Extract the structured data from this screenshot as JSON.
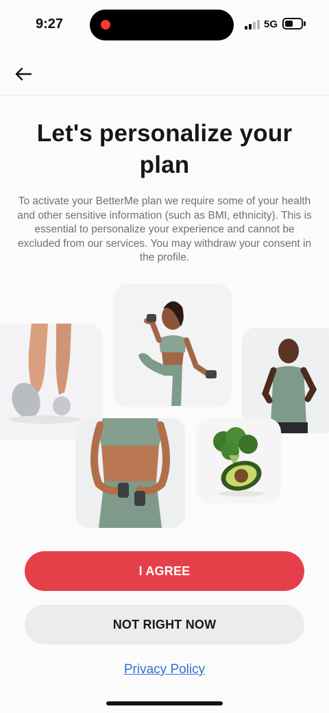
{
  "status_bar": {
    "time": "9:27",
    "network": "5G",
    "icons": [
      "recording-dot-icon",
      "signal-icon",
      "battery-icon"
    ]
  },
  "nav": {
    "back_icon": "arrow-left-icon"
  },
  "content": {
    "title": "Let's personalize your plan",
    "description": "To activate your BetterMe plan we require some of your health and other sensitive information (such as BMI, ethnicity). This is essential to personalize your experience and cannot be excluded from our services. You may withdraw your consent in the profile."
  },
  "images": [
    "legs-sneakers-image",
    "woman-dumbbells-image",
    "man-running-image",
    "torso-dumbbells-image",
    "broccoli-avocado-image"
  ],
  "actions": {
    "agree_label": "I AGREE",
    "decline_label": "NOT RIGHT NOW",
    "privacy_label": "Privacy Policy"
  },
  "colors": {
    "accent": "#e5404a",
    "secondary_button": "#ececee",
    "link": "#2f6fd6",
    "background": "#fcfbfc"
  }
}
